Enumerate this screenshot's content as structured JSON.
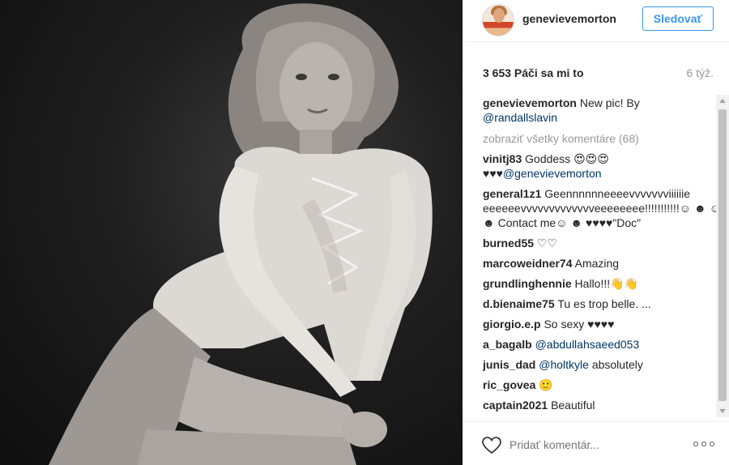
{
  "post": {
    "username": "genevievemorton",
    "follow_label": "Sledovať",
    "likes": "3 653 Páči sa mi to",
    "time_ago": "6 týž."
  },
  "caption": {
    "author": "genevievemorton",
    "text": "New pic! By",
    "mention": "@randallslavin"
  },
  "view_all_label": "zobraziť všetky komentáre (68)",
  "comments": [
    {
      "author": "vinitj83",
      "text": "Goddess 😍😍😍 ♥♥♥",
      "mention": "@genevievemorton"
    },
    {
      "author": "general1z1",
      "text": "Geennnnnneeeevvvvvvviiiiiie eeeeeevvvvvvvvvvvvveeeeeeee!!!!!!!!!!!☺ ☻ ☺ ☻  Contact me☺ ☻ ♥♥♥♥\"Doc\"",
      "mention": ""
    },
    {
      "author": "burned55",
      "text": "♡♡",
      "mention": ""
    },
    {
      "author": "marcoweidner74",
      "text": "Amazing",
      "mention": ""
    },
    {
      "author": "grundlinghennie",
      "text": "Hallo!!!👋👋",
      "mention": ""
    },
    {
      "author": "d.bienaime75",
      "text": "Tu es trop belle. ...",
      "mention": ""
    },
    {
      "author": "giorgio.e.p",
      "text": "So sexy ♥♥♥♥",
      "mention": ""
    },
    {
      "author": "a_bagalb",
      "text": "",
      "mention": "@abdullahsaeed053"
    },
    {
      "author": "junis_dad",
      "text": "absolutely",
      "mention": "@holtkyle"
    },
    {
      "author": "ric_govea",
      "text": "🙂",
      "mention": ""
    },
    {
      "author": "captain2021",
      "text": "Beautiful",
      "mention": ""
    }
  ],
  "footer": {
    "comment_placeholder": "Pridať komentár...",
    "like_icon": "heart-outline-icon",
    "more_icon": "ellipsis-icon"
  },
  "colors": {
    "accent": "#3897f0",
    "text": "#262626",
    "muted": "#999999",
    "mention": "#003569"
  }
}
